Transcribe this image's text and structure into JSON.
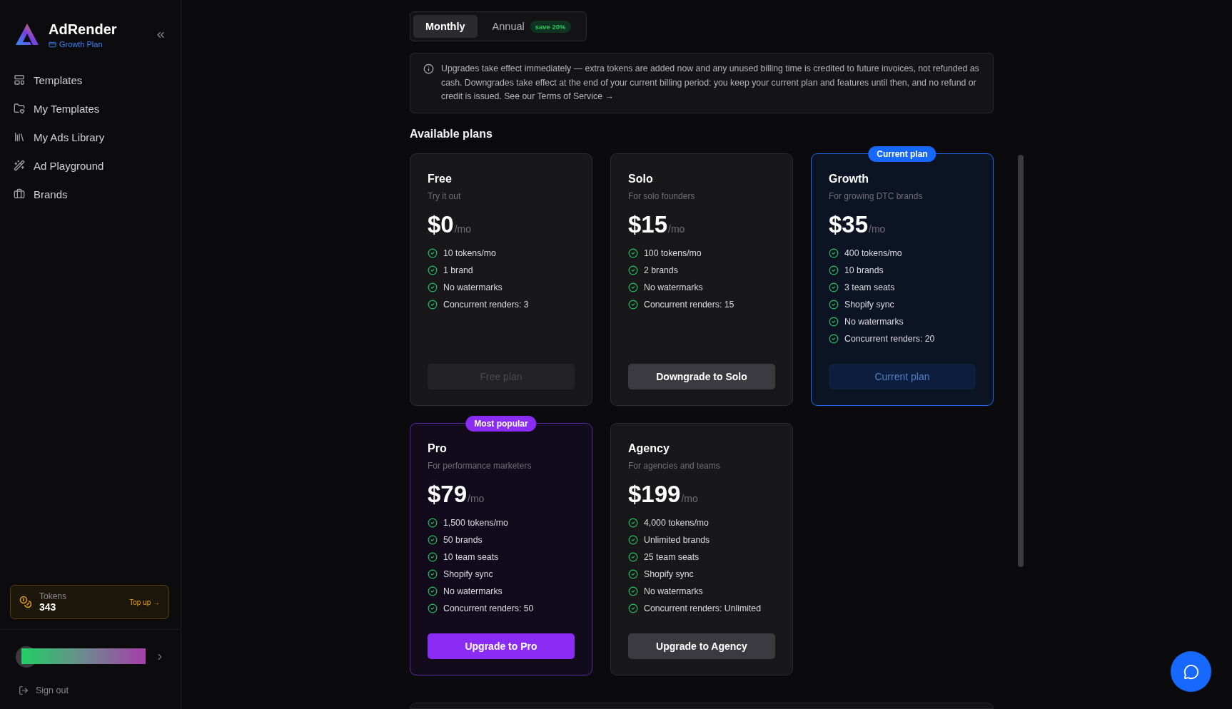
{
  "sidebar": {
    "brand": {
      "name": "AdRender",
      "plan": "Growth Plan"
    },
    "nav": [
      {
        "label": "Templates"
      },
      {
        "label": "My Templates"
      },
      {
        "label": "My Ads Library"
      },
      {
        "label": "Ad Playground"
      },
      {
        "label": "Brands"
      }
    ],
    "tokens": {
      "label": "Tokens",
      "value": "343",
      "action": "Top up →"
    },
    "sign_out": "Sign out"
  },
  "billing_toggle": [
    {
      "label": "Monthly",
      "selected": true
    },
    {
      "label": "Annual",
      "selected": false,
      "badge": "save 20%"
    }
  ],
  "notice": "Upgrades take effect immediately — extra tokens are added now and any unused billing time is credited to future invoices, not refunded as cash. Downgrades take effect at the end of your current billing period: you keep your current plan and features until then, and no refund or credit is issued. See our Terms of Service →",
  "section_title": "Available plans",
  "plans": [
    {
      "name": "Free",
      "tagline": "Try it out",
      "price": "$0",
      "period": "/mo",
      "kind": "default",
      "features": [
        "10 tokens/mo",
        "1 brand",
        "No watermarks",
        "Concurrent renders: 3"
      ],
      "button": {
        "label": "Free plan",
        "kind": "disabled"
      }
    },
    {
      "name": "Solo",
      "tagline": "For solo founders",
      "price": "$15",
      "period": "/mo",
      "kind": "default",
      "features": [
        "100 tokens/mo",
        "2 brands",
        "No watermarks",
        "Concurrent renders: 15"
      ],
      "button": {
        "label": "Downgrade to Solo",
        "kind": "secondary"
      }
    },
    {
      "name": "Growth",
      "tagline": "For growing DTC brands",
      "price": "$35",
      "period": "/mo",
      "kind": "current",
      "badge": "Current plan",
      "features": [
        "400 tokens/mo",
        "10 brands",
        "3 team seats",
        "Shopify sync",
        "No watermarks",
        "Concurrent renders: 20"
      ],
      "button": {
        "label": "Current plan",
        "kind": "current"
      }
    },
    {
      "name": "Pro",
      "tagline": "For performance marketers",
      "price": "$79",
      "period": "/mo",
      "kind": "popular",
      "badge": "Most popular",
      "features": [
        "1,500 tokens/mo",
        "50 brands",
        "10 team seats",
        "Shopify sync",
        "No watermarks",
        "Concurrent renders: 50"
      ],
      "button": {
        "label": "Upgrade to Pro",
        "kind": "primary"
      }
    },
    {
      "name": "Agency",
      "tagline": "For agencies and teams",
      "price": "$199",
      "period": "/mo",
      "kind": "default",
      "features": [
        "4,000 tokens/mo",
        "Unlimited brands",
        "25 team seats",
        "Shopify sync",
        "No watermarks",
        "Concurrent renders: Unlimited"
      ],
      "button": {
        "label": "Upgrade to Agency",
        "kind": "secondary"
      }
    }
  ]
}
